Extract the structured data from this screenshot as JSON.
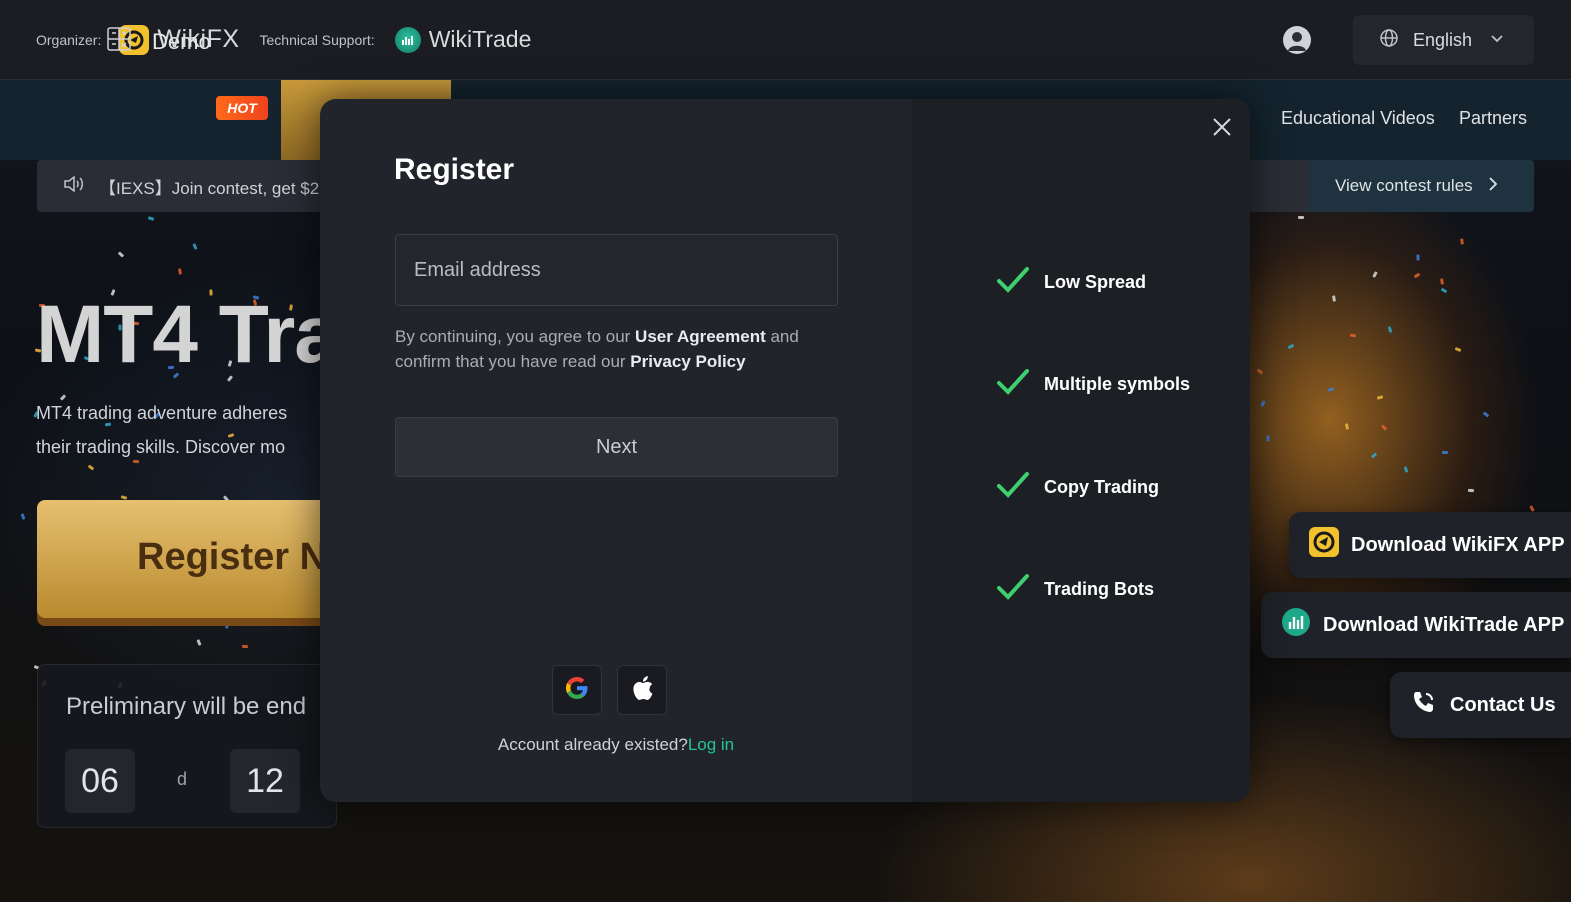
{
  "header": {
    "organizer_label": "Organizer:",
    "organizer_brand": "WikiFX",
    "support_label": "Technical Support:",
    "support_brand": "WikiTrade",
    "language": "English"
  },
  "nav": {
    "demo_label": "Demo",
    "hot_badge": "HOT",
    "items": [
      "Educational Videos",
      "Partners"
    ]
  },
  "announcement": {
    "text": "【IEXS】Join contest, get $2",
    "link": "View contest rules"
  },
  "hero": {
    "title": "MT4 Tra",
    "desc_line1": "MT4 trading adventure adheres",
    "desc_line2": "their trading skills. Discover mo",
    "register_button": "Register N",
    "countdown_label": "Preliminary will be end",
    "countdown_days": "06",
    "countdown_day_unit": "d",
    "countdown_hours": "12"
  },
  "floating": {
    "wikifx_app": "Download WikiFX APP",
    "wikitrade_app": "Download WikiTrade APP",
    "contact": "Contact Us"
  },
  "modal": {
    "title": "Register",
    "email_placeholder": "Email address",
    "agree_prefix": "By continuing, you agree to our ",
    "user_agreement": "User Agreement",
    "agree_mid": " and confirm that you have read our ",
    "privacy_policy": "Privacy Policy",
    "next_button": "Next",
    "account_existed": "Account already existed?",
    "login_link": "Log in",
    "features": [
      "Low Spread",
      "Multiple symbols",
      "Copy Trading",
      "Trading Bots"
    ]
  },
  "colors": {
    "accent_green": "#26c49a",
    "check_green": "#3ecf6e",
    "wikifx_yellow": "#f2c12e"
  },
  "icons": [
    "calculator-icon",
    "speaker-icon",
    "globe-icon",
    "chevron-down-icon",
    "chevron-right-icon",
    "user-icon",
    "close-icon",
    "check-icon",
    "google-icon",
    "apple-icon",
    "phone-icon"
  ]
}
